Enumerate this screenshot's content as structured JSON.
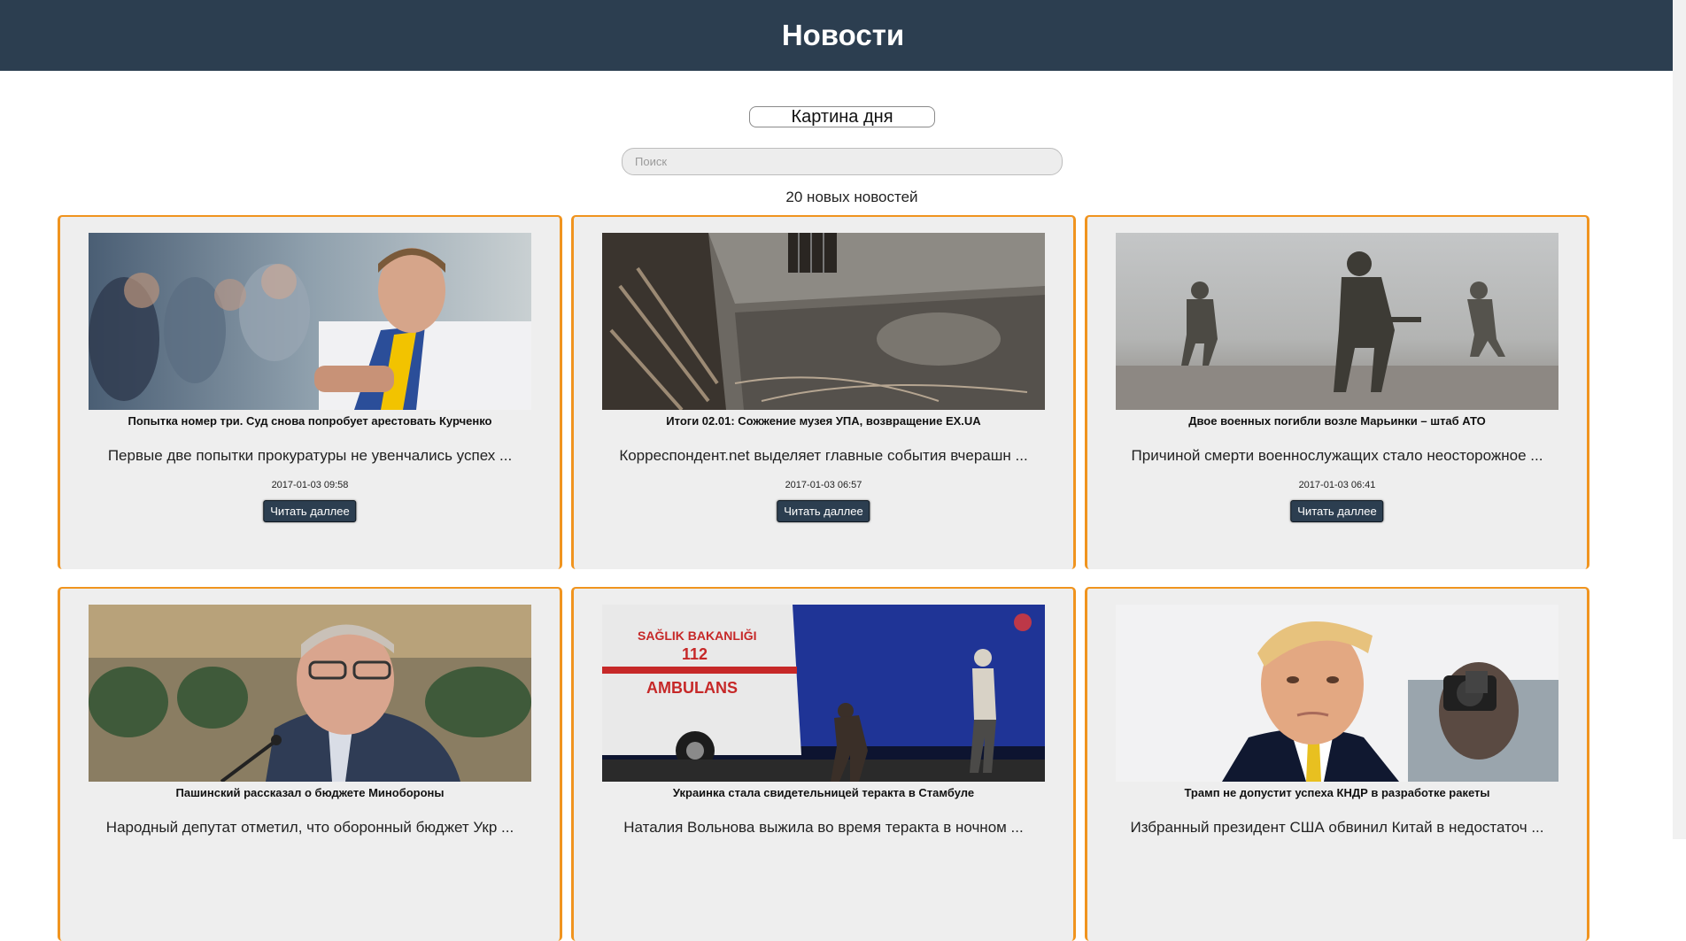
{
  "header": {
    "title": "Новости"
  },
  "picture_of_day": {
    "label": "Картина дня"
  },
  "search": {
    "placeholder": "Поиск",
    "value": ""
  },
  "news_count": "20 новых новостей",
  "cards": [
    {
      "title": "Попытка номер три. Суд снова попробует арестовать Курченко",
      "excerpt": "Первые две попытки прокуратуры не увенчались успех ...",
      "date": "2017-01-03 09:58",
      "button": "Читать даллее",
      "image": "photo-man-in-stadium-with-scarf"
    },
    {
      "title": "Итоги 02.01: Сожжение музея УПА, возвращение EX.UA",
      "excerpt": "Корреспондент.net выделяет главные события вчерашн ...",
      "date": "2017-01-03 06:57",
      "button": "Читать даллее",
      "image": "photo-burned-building-ruins"
    },
    {
      "title": "Двое военных погибли возле Марьинки – штаб АТО",
      "excerpt": "Причиной смерти военнослужащих стало неосторожное ...",
      "date": "2017-01-03 06:41",
      "button": "Читать даллее",
      "image": "photo-soldiers-in-fog"
    },
    {
      "title": "Пашинский рассказал о бюджете Минобороны",
      "excerpt": "Народный депутат отметил, что оборонный бюджет Укр ...",
      "date": "",
      "button": "",
      "image": "photo-man-in-parliament"
    },
    {
      "title": "Украинка стала свидетельницей теракта в Стамбуле",
      "excerpt": "Наталия Вольнова выжила во время теракта в ночном ...",
      "date": "",
      "button": "",
      "image": "photo-ambulance-at-night"
    },
    {
      "title": "Трамп не допустит успеха КНДР в разработке ракеты",
      "excerpt": "Избранный президент США обвинил Китай в недостаточ ...",
      "date": "",
      "button": "",
      "image": "photo-man-in-suit-with-photographers"
    }
  ],
  "image_labels": {
    "ambulance_line1": "SAĞLIK BAKANLIĞI",
    "ambulance_number": "112",
    "ambulance_line2": "AMBULANS"
  }
}
